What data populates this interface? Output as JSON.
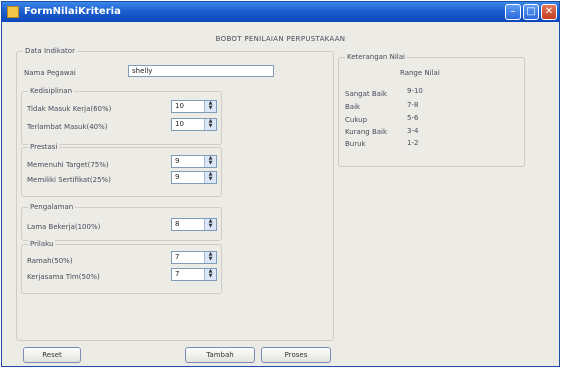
{
  "window": {
    "title": "FormNilaiKriteria"
  },
  "heading": "BOBOT PENILAIAN PERPUSTAKAAN",
  "data_indikator": {
    "legend": "Data Indikator",
    "nama_pegawai": {
      "label": "Nama Pegawai",
      "value": "shelly"
    },
    "kedisiplinan": {
      "legend": "Kedisiplinan",
      "tidak_masuk": {
        "label": "Tidak Masuk Kerja(60%)",
        "value": "10"
      },
      "terlambat": {
        "label": "Terlambat Masuk(40%)",
        "value": "10"
      }
    },
    "prestasi": {
      "legend": "Prestasi",
      "memenuhi_target": {
        "label": "Memenuhi Target(75%)",
        "value": "9"
      },
      "memiliki_sertifikat": {
        "label": "Memiliki Sertifikat(25%)",
        "value": "9"
      }
    },
    "pengalaman": {
      "legend": "Pengalaman",
      "lama_bekerja": {
        "label": "Lama Bekerja(100%)",
        "value": "8"
      }
    },
    "prilaku": {
      "legend": "Prilaku",
      "ramah": {
        "label": "Ramah(50%)",
        "value": "7"
      },
      "kerjasama_tim": {
        "label": "Kerjasama Tim(50%)",
        "value": "7"
      }
    }
  },
  "keterangan_nilai": {
    "legend": "Keterangan Nilai",
    "header": "Range Nilai",
    "rows": [
      {
        "label": "Sangat Baik",
        "range": "9-10"
      },
      {
        "label": "Baik",
        "range": "7-8"
      },
      {
        "label": "Cukup",
        "range": "5-6"
      },
      {
        "label": "Kurang Baik",
        "range": "3-4"
      },
      {
        "label": "Buruk",
        "range": "1-2"
      }
    ]
  },
  "buttons": {
    "reset": "Reset",
    "tambah": "Tambah",
    "proses": "Proses"
  }
}
